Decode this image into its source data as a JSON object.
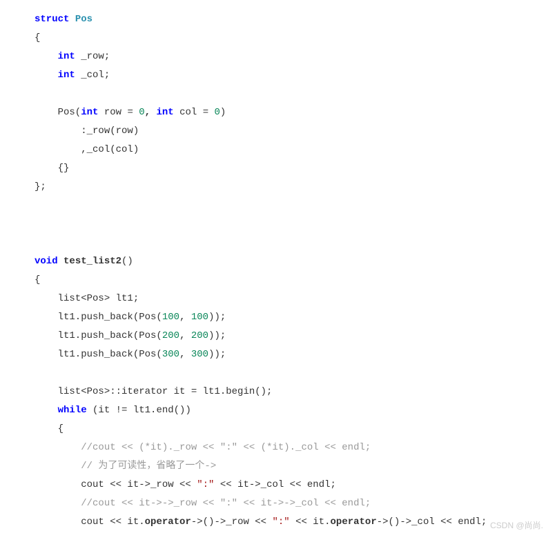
{
  "code": {
    "lines": [
      {
        "indent": 0,
        "segments": [
          {
            "text": "struct",
            "cls": "kw"
          },
          {
            "text": " ",
            "cls": ""
          },
          {
            "text": "Pos",
            "cls": "type bold"
          }
        ]
      },
      {
        "indent": 0,
        "segments": [
          {
            "text": "{",
            "cls": ""
          }
        ]
      },
      {
        "indent": 1,
        "segments": [
          {
            "text": "int",
            "cls": "kw"
          },
          {
            "text": " _row;",
            "cls": ""
          }
        ]
      },
      {
        "indent": 1,
        "segments": [
          {
            "text": "int",
            "cls": "kw"
          },
          {
            "text": " _col;",
            "cls": ""
          }
        ]
      },
      {
        "indent": 0,
        "segments": []
      },
      {
        "indent": 1,
        "segments": [
          {
            "text": "Pos(",
            "cls": ""
          },
          {
            "text": "int",
            "cls": "kw"
          },
          {
            "text": " row = ",
            "cls": ""
          },
          {
            "text": "0",
            "cls": "num"
          },
          {
            "text": ", ",
            "cls": "bold"
          },
          {
            "text": "int",
            "cls": "kw"
          },
          {
            "text": " col = ",
            "cls": ""
          },
          {
            "text": "0",
            "cls": "num"
          },
          {
            "text": ")",
            "cls": ""
          }
        ]
      },
      {
        "indent": 2,
        "segments": [
          {
            "text": ":_row(row)",
            "cls": ""
          }
        ]
      },
      {
        "indent": 2,
        "segments": [
          {
            "text": ",_col(col)",
            "cls": ""
          }
        ]
      },
      {
        "indent": 1,
        "segments": [
          {
            "text": "{}",
            "cls": ""
          }
        ]
      },
      {
        "indent": 0,
        "segments": [
          {
            "text": "};",
            "cls": ""
          }
        ]
      },
      {
        "indent": 0,
        "segments": []
      },
      {
        "indent": 0,
        "segments": []
      },
      {
        "indent": 0,
        "segments": []
      },
      {
        "indent": 0,
        "segments": [
          {
            "text": "void",
            "cls": "kw"
          },
          {
            "text": " ",
            "cls": ""
          },
          {
            "text": "test_list2",
            "cls": "bold"
          },
          {
            "text": "()",
            "cls": ""
          }
        ]
      },
      {
        "indent": 0,
        "segments": [
          {
            "text": "{",
            "cls": ""
          }
        ]
      },
      {
        "indent": 1,
        "segments": [
          {
            "text": "list<Pos> lt1;",
            "cls": ""
          }
        ]
      },
      {
        "indent": 1,
        "segments": [
          {
            "text": "lt1.push_back(Pos(",
            "cls": ""
          },
          {
            "text": "100",
            "cls": "num"
          },
          {
            "text": ", ",
            "cls": ""
          },
          {
            "text": "100",
            "cls": "num"
          },
          {
            "text": "));",
            "cls": ""
          }
        ]
      },
      {
        "indent": 1,
        "segments": [
          {
            "text": "lt1.push_back(Pos(",
            "cls": ""
          },
          {
            "text": "200",
            "cls": "num"
          },
          {
            "text": ", ",
            "cls": ""
          },
          {
            "text": "200",
            "cls": "num"
          },
          {
            "text": "));",
            "cls": ""
          }
        ]
      },
      {
        "indent": 1,
        "segments": [
          {
            "text": "lt1.push_back(Pos(",
            "cls": ""
          },
          {
            "text": "300",
            "cls": "num"
          },
          {
            "text": ", ",
            "cls": ""
          },
          {
            "text": "300",
            "cls": "num"
          },
          {
            "text": "));",
            "cls": ""
          }
        ]
      },
      {
        "indent": 0,
        "segments": []
      },
      {
        "indent": 1,
        "segments": [
          {
            "text": "list<Pos>::iterator it = lt1.begin();",
            "cls": ""
          }
        ]
      },
      {
        "indent": 1,
        "segments": [
          {
            "text": "while",
            "cls": "kw"
          },
          {
            "text": " (it != lt1.end())",
            "cls": ""
          }
        ]
      },
      {
        "indent": 1,
        "segments": [
          {
            "text": "{",
            "cls": ""
          }
        ]
      },
      {
        "indent": 2,
        "segments": [
          {
            "text": "//cout << (*it)._row << \":\" << (*it)._col << endl;",
            "cls": "comment"
          }
        ]
      },
      {
        "indent": 2,
        "segments": [
          {
            "text": "// 为了可读性，省略了一个->",
            "cls": "comment"
          }
        ]
      },
      {
        "indent": 2,
        "segments": [
          {
            "text": "cout << it->_row << ",
            "cls": ""
          },
          {
            "text": "\":\"",
            "cls": "str"
          },
          {
            "text": " << it->_col << endl;",
            "cls": ""
          }
        ]
      },
      {
        "indent": 2,
        "segments": [
          {
            "text": "//cout << it->->_row << \":\" << it->->_col << endl;",
            "cls": "comment"
          }
        ]
      },
      {
        "indent": 2,
        "segments": [
          {
            "text": "cout << it.",
            "cls": ""
          },
          {
            "text": "operator",
            "cls": "bold"
          },
          {
            "text": "->()->_row << ",
            "cls": ""
          },
          {
            "text": "\":\"",
            "cls": "str"
          },
          {
            "text": " << it.",
            "cls": ""
          },
          {
            "text": "operator",
            "cls": "bold"
          },
          {
            "text": "->()->_col << endl;",
            "cls": ""
          }
        ]
      }
    ]
  },
  "watermark": "CSDN @尚尚."
}
